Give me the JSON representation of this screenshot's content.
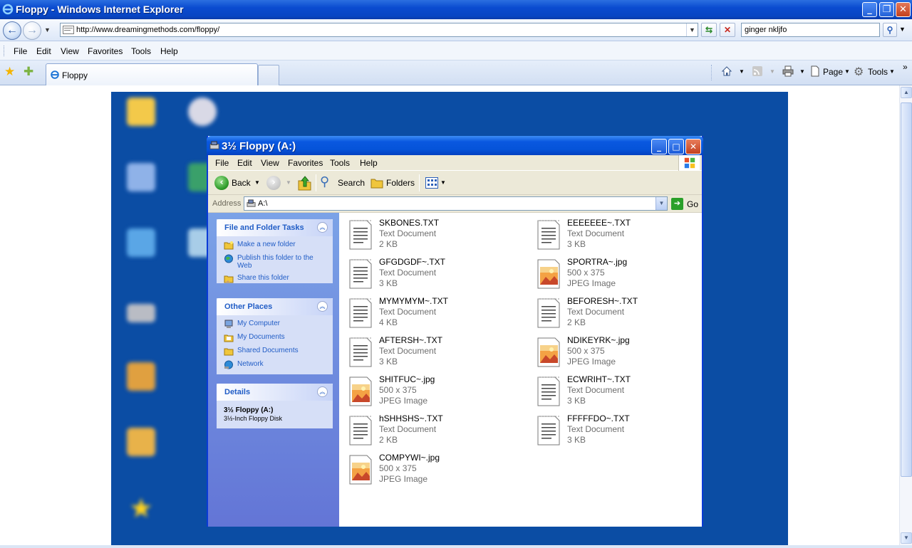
{
  "browser": {
    "title": "Floppy - Windows Internet Explorer",
    "url": "http://www.dreamingmethods.com/floppy/",
    "search_value": "ginger nkljfo",
    "menu": [
      "File",
      "Edit",
      "View",
      "Favorites",
      "Tools",
      "Help"
    ],
    "tab_title": "Floppy",
    "cmd_page": "Page",
    "cmd_tools": "Tools"
  },
  "explorer": {
    "title": "3½ Floppy (A:)",
    "menu": [
      "File",
      "Edit",
      "View",
      "Favorites",
      "Tools",
      "Help"
    ],
    "toolbar": {
      "back": "Back",
      "search": "Search",
      "folders": "Folders"
    },
    "address_label": "Address",
    "address_value": "A:\\",
    "go_label": "Go",
    "panels": {
      "tasks": {
        "title": "File and Folder Tasks",
        "links": [
          "Make a new folder",
          "Publish this folder to the Web",
          "Share this folder"
        ]
      },
      "places": {
        "title": "Other Places",
        "links": [
          "My Computer",
          "My Documents",
          "Shared Documents",
          "Network"
        ]
      },
      "details": {
        "title": "Details",
        "name": "3½ Floppy (A:)",
        "sub": "3½-Inch Floppy Disk"
      }
    },
    "files": [
      {
        "name": "SKBONES.TXT",
        "line2": "Text Document",
        "line3": "2 KB",
        "kind": "txt"
      },
      {
        "name": "EEEEEEE~.TXT",
        "line2": "Text Document",
        "line3": "3 KB",
        "kind": "txt"
      },
      {
        "name": "GFGDGDF~.TXT",
        "line2": "Text Document",
        "line3": "3 KB",
        "kind": "txt"
      },
      {
        "name": "SPORTRA~.jpg",
        "line2": "500 x 375",
        "line3": "JPEG Image",
        "kind": "jpg"
      },
      {
        "name": "MYMYMYM~.TXT",
        "line2": "Text Document",
        "line3": "4 KB",
        "kind": "txt"
      },
      {
        "name": "BEFORESH~.TXT",
        "line2": "Text Document",
        "line3": "2 KB",
        "kind": "txt"
      },
      {
        "name": "AFTERSH~.TXT",
        "line2": "Text Document",
        "line3": "3 KB",
        "kind": "txt"
      },
      {
        "name": "NDIKEYRK~.jpg",
        "line2": "500 x 375",
        "line3": "JPEG Image",
        "kind": "jpg"
      },
      {
        "name": "SHITFUC~.jpg",
        "line2": "500 x 375",
        "line3": "JPEG Image",
        "kind": "jpg"
      },
      {
        "name": "ECWRIHT~.TXT",
        "line2": "Text Document",
        "line3": "3 KB",
        "kind": "txt"
      },
      {
        "name": "hSHHSHS~.TXT",
        "line2": "Text Document",
        "line3": "2 KB",
        "kind": "txt"
      },
      {
        "name": "FFFFFDO~.TXT",
        "line2": "Text Document",
        "line3": "3 KB",
        "kind": "txt"
      },
      {
        "name": "COMPYWI~.jpg",
        "line2": "500 x 375",
        "line3": "JPEG Image",
        "kind": "jpg"
      }
    ]
  }
}
